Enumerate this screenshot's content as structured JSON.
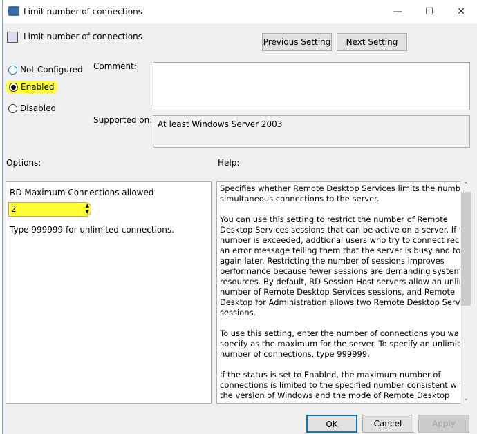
{
  "window": {
    "title": "Limit number of connections",
    "minimize": "—",
    "maximize": "☐",
    "close": "✕"
  },
  "header": {
    "policy_name": "Limit number of connections",
    "previous_setting": "Previous Setting",
    "next_setting": "Next Setting"
  },
  "state": {
    "options": [
      {
        "label": "Not Configured",
        "selected": false
      },
      {
        "label": "Enabled",
        "selected": true
      },
      {
        "label": "Disabled",
        "selected": false
      }
    ]
  },
  "comment": {
    "label": "Comment:",
    "value": ""
  },
  "supported": {
    "label": "Supported on:",
    "value": "At least Windows Server 2003"
  },
  "options": {
    "label": "Options:",
    "field_label": "RD Maximum Connections allowed",
    "value": "2",
    "hint": "Type 999999 for unlimited connections."
  },
  "help": {
    "label": "Help:",
    "text": "Specifies whether Remote Desktop Services limits the number of\nsimultaneous connections to the server.\n\nYou can use this setting to restrict the number of Remote\nDesktop Services sessions that can be active on a server. If this\nnumber is exceeded, addtional users who try to connect receive\nan error message telling them that the server is busy and to try\nagain later. Restricting the number of sessions improves\nperformance because fewer sessions are demanding system\nresources. By default, RD Session Host servers allow an unlimited\nnumber of Remote Desktop Services sessions, and Remote\nDesktop for Administration allows two Remote Desktop Services\nsessions.\n\nTo use this setting, enter the number of connections you want to\nspecify as the maximum for the server. To specify an unlimited\nnumber of connections, type 999999.\n\nIf the status is set to Enabled, the maximum number of\nconnections is limited to the specified number consistent with\nthe version of Windows and the mode of Remote Desktop"
  },
  "footer": {
    "ok": "OK",
    "cancel": "Cancel",
    "apply": "Apply"
  },
  "colors": {
    "highlight": "#ffff33",
    "focus": "#0078d7"
  }
}
